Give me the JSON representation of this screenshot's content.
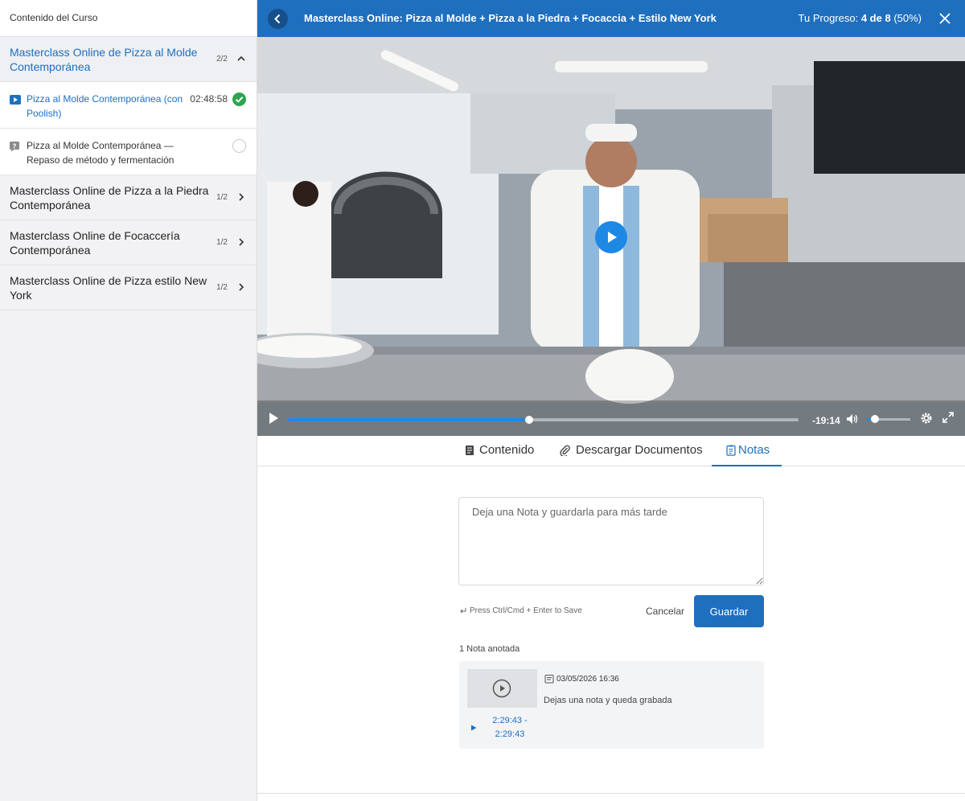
{
  "sidebar": {
    "title": "Contenido del Curso",
    "sections": [
      {
        "label": "Masterclass Online de Pizza al Molde Contemporánea",
        "count": "2/2",
        "open": true,
        "lessons": [
          {
            "label": "Pizza al Molde Contemporánea (con Poolish)",
            "duration": "02:48:58",
            "type": "video-icon",
            "status": "completed"
          },
          {
            "label": "Pizza al Molde Contemporánea — Repaso de método y fermentación",
            "duration": "",
            "type": "quiz-icon",
            "status": "pending"
          }
        ]
      },
      {
        "label": "Masterclass Online de Pizza a la Piedra Contemporánea",
        "count": "1/2"
      },
      {
        "label": "Masterclass Online de Focaccería Contemporánea",
        "count": "1/2"
      },
      {
        "label": "Masterclass Online de Pizza estilo New York",
        "count": "1/2"
      }
    ]
  },
  "header": {
    "title": "Masterclass Online: Pizza al Molde + Pizza a la Piedra + Focaccia + Estilo New York",
    "progress_prefix": "Tu Progreso: ",
    "progress_value": "4 de 8",
    "progress_pct": "(50%)"
  },
  "player": {
    "time_remaining": "-19:14",
    "progress_fraction": 0.472,
    "volume_fraction": 0.18,
    "accent": "#1e88e5"
  },
  "tabs": [
    {
      "label": "Contenido",
      "icon": "document-icon"
    },
    {
      "label": "Descargar Documentos",
      "icon": "paperclip-icon"
    },
    {
      "label": "Notas",
      "icon": "notes-icon",
      "active": true
    }
  ],
  "notes": {
    "placeholder": "Deja una Nota y guardarla para más tarde",
    "hint": "Press Ctrl/Cmd + Enter to Save",
    "cancel_label": "Cancelar",
    "save_label": "Guardar",
    "count_label": "1 Nota anotada",
    "items": [
      {
        "date": "03/05/2026 16:36",
        "text": "Dejas una nota y queda grabada",
        "range": "2:29:43 - 2:29:43"
      }
    ]
  },
  "colors": {
    "brand": "#1f6fbf",
    "success": "#2ea44f"
  }
}
